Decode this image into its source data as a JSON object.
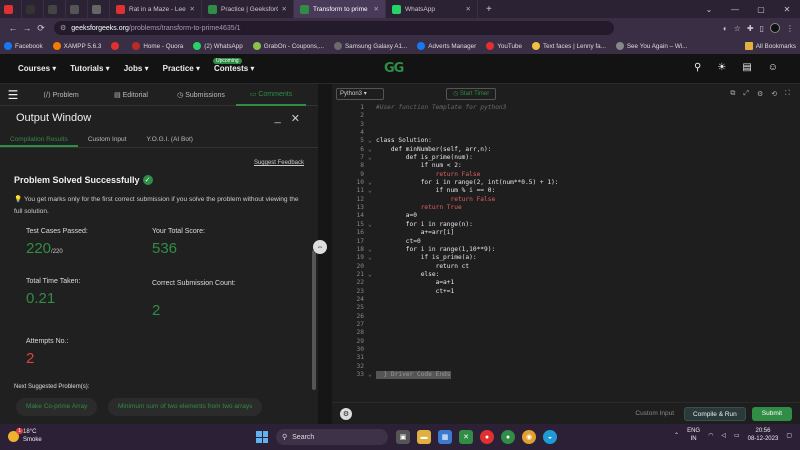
{
  "browser": {
    "tabs": [
      {
        "label": "",
        "icon": "youtube-icon",
        "color": "#e03030",
        "active": false
      },
      {
        "label": "",
        "icon": "github-icon",
        "color": "#333333",
        "active": false
      },
      {
        "label": "",
        "icon": "bookmark-icon",
        "color": "#444444",
        "active": false
      },
      {
        "label": "",
        "icon": "cc-icon",
        "color": "#555555",
        "active": false
      },
      {
        "label": "",
        "icon": "image-icon",
        "color": "#666666",
        "active": false
      },
      {
        "label": "Rat in a Maze - Leetcode - Tuto",
        "icon": "youtube-icon",
        "color": "#e03030",
        "active": false
      },
      {
        "label": "Practice | GeeksforGeeks | A com",
        "icon": "gfg-icon",
        "color": "#2f8d46",
        "active": false
      },
      {
        "label": "Transform to prime | Practice | G",
        "icon": "gfg-icon",
        "color": "#2f8d46",
        "active": true
      },
      {
        "label": "WhatsApp",
        "icon": "whatsapp-icon",
        "color": "#25d366",
        "active": false
      }
    ],
    "url_host": "geeksforgeeks.org",
    "url_path": "/problems/transform-to-prime4635/1",
    "bookmarks": [
      {
        "label": "Facebook",
        "color": "#1877f2"
      },
      {
        "label": "XAMPP 5.6.3",
        "color": "#f57c00"
      },
      {
        "label": "",
        "color": "#e03030"
      },
      {
        "label": "Home - Quora",
        "color": "#b92b27"
      },
      {
        "label": "(2) WhatsApp",
        "color": "#25d366"
      },
      {
        "label": "GrabOn - Coupons,...",
        "color": "#8bc34a"
      },
      {
        "label": "Samsung Galaxy A1...",
        "color": "#6a6a6a"
      },
      {
        "label": "Adverts Manager",
        "color": "#1877f2"
      },
      {
        "label": "YouTube",
        "color": "#e03030"
      },
      {
        "label": "Text faces | Lenny fa...",
        "color": "#f0c040"
      },
      {
        "label": "See You Again – Wi...",
        "color": "#888888"
      }
    ],
    "all_bookmarks": "All Bookmarks"
  },
  "header": {
    "nav": [
      "Courses ▾",
      "Tutorials ▾",
      "Jobs ▾",
      "Practice ▾",
      "Contests ▾"
    ],
    "upcoming_badge": "Upcoming",
    "logo": "GG"
  },
  "left_panel": {
    "tabs": [
      "Problem",
      "Editorial",
      "Submissions",
      "Comments"
    ],
    "output_title": "Output Window",
    "subtabs": [
      "Compilation Results",
      "Custom Input",
      "Y.O.G.I. (AI Bot)"
    ],
    "suggest_feedback": "Suggest Feedback",
    "solved_title": "Problem Solved Successfully",
    "hint": "You get marks only for the first correct submission if you solve the problem without viewing the full solution.",
    "stats": {
      "test_cases_label": "Test Cases Passed:",
      "test_cases_value": "220",
      "test_cases_total": "/220",
      "score_label": "Your Total Score:",
      "score_value": "536",
      "time_label": "Total Time Taken:",
      "time_value": "0.21",
      "correct_label": "Correct Submission Count:",
      "correct_value": "2",
      "attempts_label": "Attempts No.:",
      "attempts_value": "2"
    },
    "next_label": "Next Suggested Problem(s):",
    "suggested": [
      "Make Co-prime Array",
      "Minimum sum of two elements from two arrays"
    ]
  },
  "editor": {
    "language": "Python3",
    "start_timer": "Start Timer",
    "lines": [
      "#User function Template for python3",
      "",
      "",
      "",
      "class Solution:",
      "    def minNumber(self, arr,n):",
      "        def is_prime(num):",
      "            if num < 2:",
      "                return False",
      "            for i in range(2, int(num**0.5) + 1):",
      "                if num % i == 0:",
      "                    return False",
      "            return True",
      "        a=0",
      "        for i in range(n):",
      "            a+=arr[i]",
      "        ct=0",
      "        for i in range(1,10**9):",
      "            if is_prime(a):",
      "                return ct",
      "            else:",
      "                a=a+1",
      "                ct+=1",
      "",
      "",
      "",
      "",
      "",
      "",
      "",
      "",
      "",
      "  } Driver Code Ends"
    ],
    "custom_input": "Custom Input",
    "compile_run": "Compile & Run",
    "submit": "Submit"
  },
  "taskbar": {
    "temp": "18°C",
    "weather": "Smoke",
    "search_placeholder": "Search",
    "lang1": "ENG",
    "lang2": "IN",
    "time": "20:56",
    "date": "08-12-2023"
  }
}
